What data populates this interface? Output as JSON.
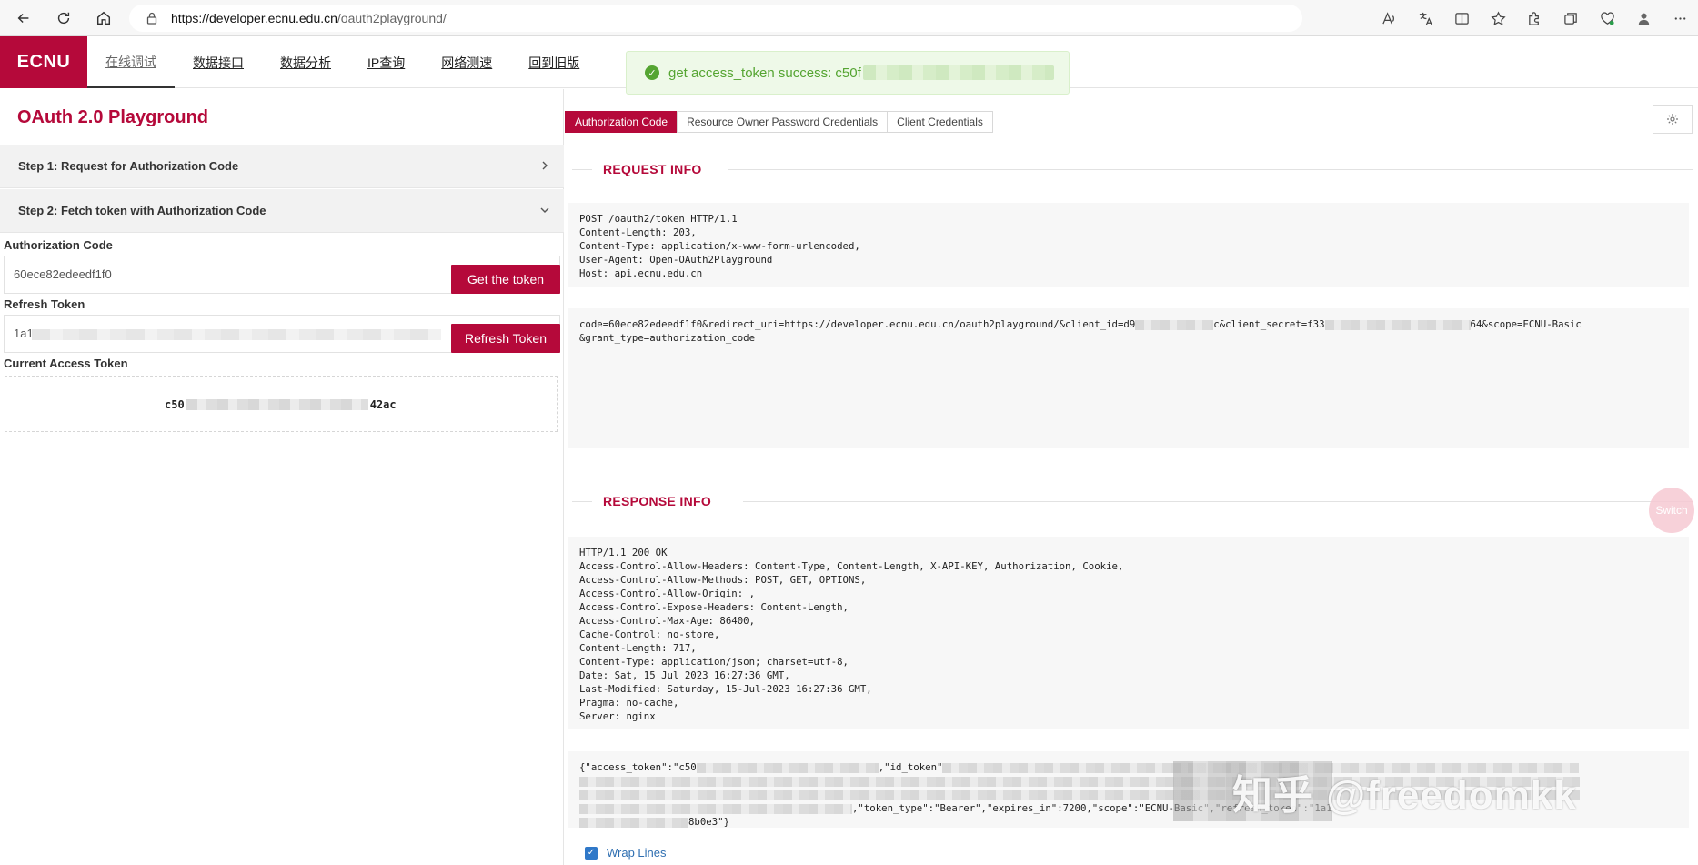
{
  "browser": {
    "url_host": "https://developer.ecnu.edu.cn",
    "url_path": "/oauth2playground/"
  },
  "header": {
    "logo": "ECNU",
    "nav": [
      {
        "label": "在线调试",
        "active": true
      },
      {
        "label": "数据接口"
      },
      {
        "label": "数据分析"
      },
      {
        "label": "IP查询"
      },
      {
        "label": "网络测速"
      },
      {
        "label": "回到旧版"
      }
    ]
  },
  "toast": {
    "message": "get access_token success: c50f"
  },
  "left": {
    "title": "OAuth 2.0 Playground",
    "step1": "Step 1: Request for Authorization Code",
    "step2": "Step 2: Fetch token with Authorization Code",
    "auth_code_label": "Authorization Code",
    "auth_code_value": "60ece82edeedf1f0",
    "get_token_button": "Get the token",
    "refresh_token_label": "Refresh Token",
    "refresh_token_value": "1a1",
    "refresh_token_button": "Refresh Token",
    "current_token_label": "Current Access Token",
    "current_token_prefix": "c50",
    "current_token_suffix": "42ac"
  },
  "right": {
    "tabs": [
      {
        "label": "Authorization Code",
        "active": true
      },
      {
        "label": "Resource Owner Password Credentials"
      },
      {
        "label": "Client Credentials"
      }
    ],
    "request_title": "REQUEST INFO",
    "request_headers": "POST /oauth2/token HTTP/1.1\nContent-Length: 203,\nContent-Type: application/x-www-form-urlencoded,\nUser-Agent: Open-OAuth2Playground\nHost: api.ecnu.edu.cn",
    "request_body_a": "code=60ece82edeedf1f0&redirect_uri=https://developer.ecnu.edu.cn/oauth2playground/&client_id=d9",
    "request_body_b": "c&client_secret=f33",
    "request_body_c": "64&scope=ECNU-Basic",
    "request_body_d": "&grant_type=authorization_code",
    "response_title": "RESPONSE INFO",
    "response_headers": "HTTP/1.1 200 OK\nAccess-Control-Allow-Headers: Content-Type, Content-Length, X-API-KEY, Authorization, Cookie,\nAccess-Control-Allow-Methods: POST, GET, OPTIONS,\nAccess-Control-Allow-Origin: ,\nAccess-Control-Expose-Headers: Content-Length,\nAccess-Control-Max-Age: 86400,\nCache-Control: no-store,\nContent-Length: 717,\nContent-Type: application/json; charset=utf-8,\nDate: Sat, 15 Jul 2023 16:27:36 GMT,\nLast-Modified: Saturday, 15-Jul-2023 16:27:36 GMT,\nPragma: no-cache,\nServer: nginx",
    "response_body_a": "{\"access_token\":\"c50",
    "response_body_b": ",\"id_token\"",
    "response_body_c": ",\"token_type\":\"Bearer\",\"expires_in\":7200,\"scope\":\"ECNU-Basic\",\"refresh_token\":\"1a1",
    "response_body_d": "8b0e3\"}",
    "switch_label": "Switch",
    "wrap_lines_label": "Wrap Lines",
    "watermark": "知乎 @freedomkk"
  }
}
